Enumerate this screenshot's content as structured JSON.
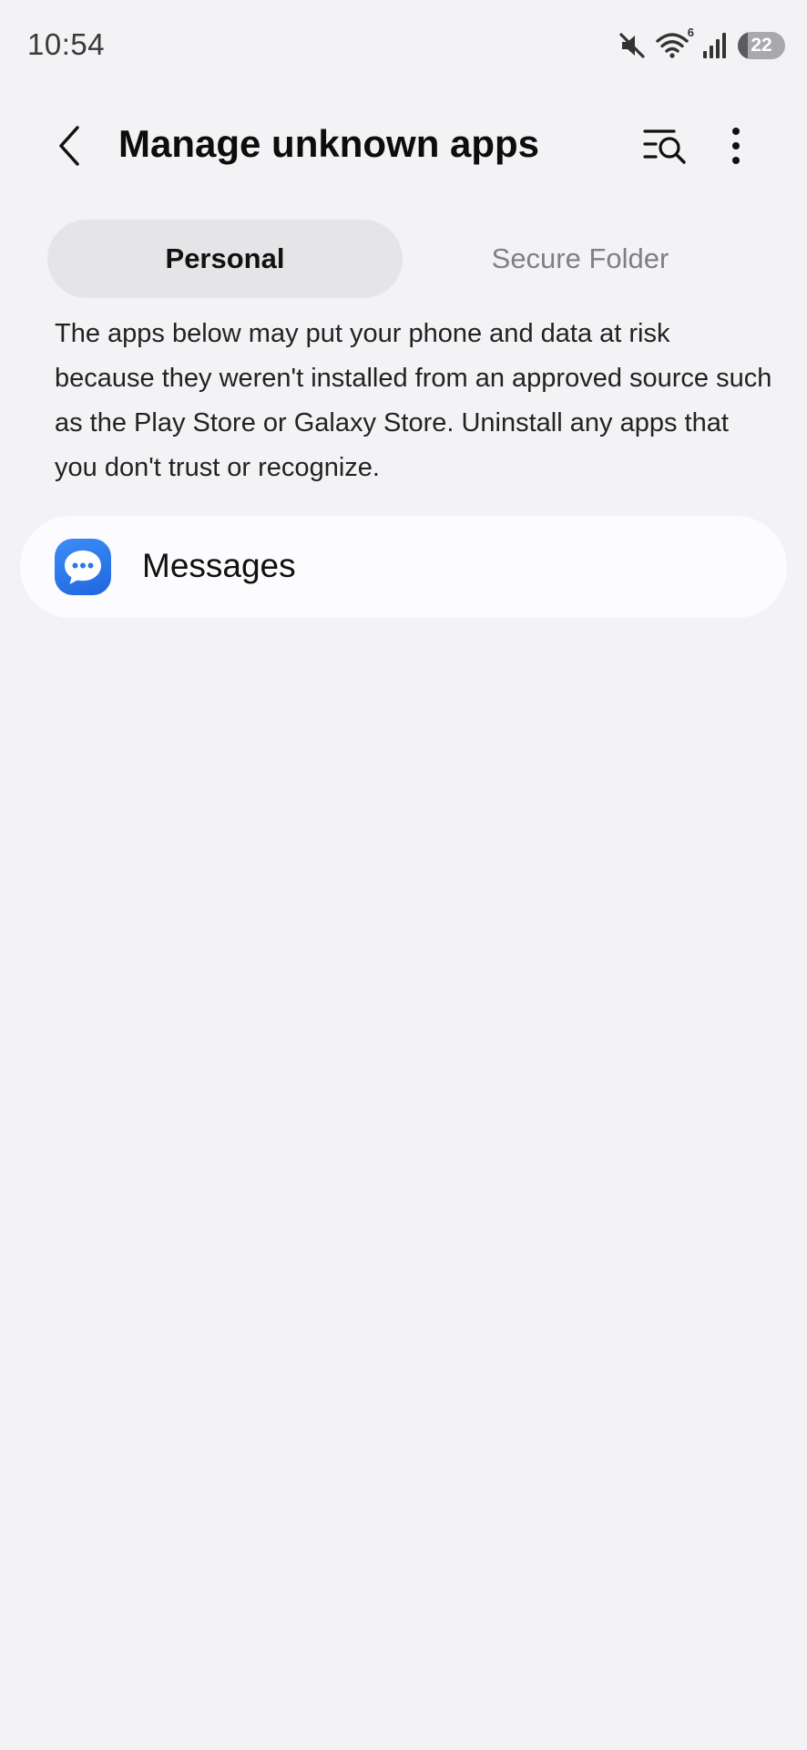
{
  "status_bar": {
    "time": "10:54",
    "battery_level": "22",
    "wifi_label": "6",
    "icons": [
      "mute-icon",
      "wifi-icon",
      "signal-icon",
      "battery-icon"
    ]
  },
  "header": {
    "title": "Manage unknown apps",
    "back_icon": "chevron-left-icon",
    "search_icon": "list-search-icon",
    "more_icon": "more-vertical-icon"
  },
  "tabs": [
    {
      "label": "Personal",
      "selected": true
    },
    {
      "label": "Secure Folder",
      "selected": false
    }
  ],
  "description": "The apps below may put your phone and data at risk because they weren't installed from an approved source such as the Play Store or Galaxy Store. Uninstall any apps that you don't trust or recognize.",
  "apps": [
    {
      "name": "Messages",
      "icon": "messages-app-icon"
    }
  ],
  "colors": {
    "background": "#f3f3f6",
    "tab_selected": "#e5e5e8",
    "card": "#fcfcfe",
    "accent_blue": "#2a76ec",
    "muted_text": "#808084"
  }
}
